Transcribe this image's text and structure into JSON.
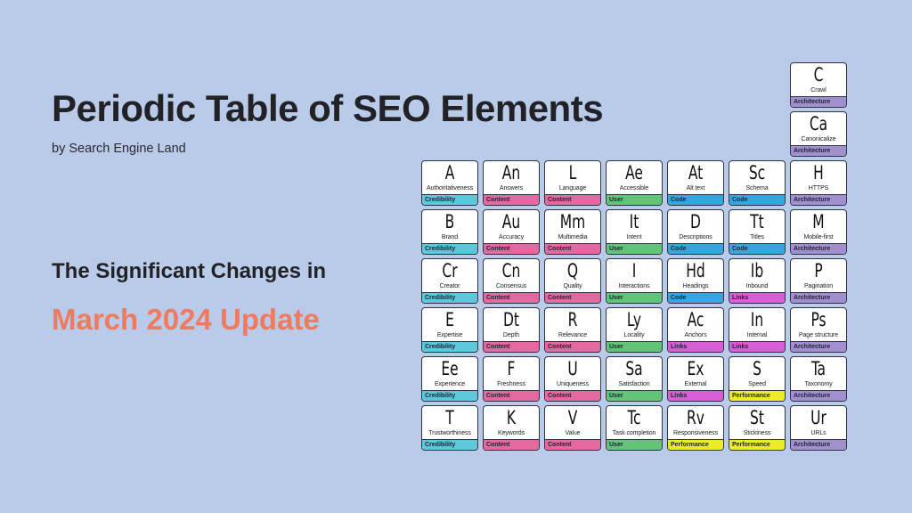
{
  "header": {
    "title": "Periodic Table of SEO Elements",
    "byline": "by Search Engine Land",
    "subhead": "The Significant Changes in",
    "highlight": "March 2024 Update"
  },
  "colors": {
    "background": "#b9cbe8",
    "highlight": "#f07a5e",
    "categories": {
      "Credibility": "#5bc8dc",
      "Content": "#e569a1",
      "User": "#62c478",
      "Code": "#35a7de",
      "Links": "#d65fd6",
      "Performance": "#ecec2a",
      "Architecture": "#a18fcf"
    }
  },
  "table": {
    "top_cells": [
      {
        "symbol": "C",
        "name": "Crawl",
        "category": "Architecture"
      },
      {
        "symbol": "Ca",
        "name": "Canonicalize",
        "category": "Architecture"
      }
    ],
    "rows": [
      [
        {
          "symbol": "A",
          "name": "Authoritativeness",
          "category": "Credibility"
        },
        {
          "symbol": "An",
          "name": "Answers",
          "category": "Content"
        },
        {
          "symbol": "L",
          "name": "Language",
          "category": "Content"
        },
        {
          "symbol": "Ae",
          "name": "Accessible",
          "category": "User"
        },
        {
          "symbol": "At",
          "name": "Alt text",
          "category": "Code"
        },
        {
          "symbol": "Sc",
          "name": "Schema",
          "category": "Code"
        },
        {
          "symbol": "H",
          "name": "HTTPS",
          "category": "Architecture"
        }
      ],
      [
        {
          "symbol": "B",
          "name": "Brand",
          "category": "Credibility"
        },
        {
          "symbol": "Au",
          "name": "Accuracy",
          "category": "Content"
        },
        {
          "symbol": "Mm",
          "name": "Multimedia",
          "category": "Content"
        },
        {
          "symbol": "It",
          "name": "Intent",
          "category": "User"
        },
        {
          "symbol": "D",
          "name": "Descriptions",
          "category": "Code"
        },
        {
          "symbol": "Tt",
          "name": "Titles",
          "category": "Code"
        },
        {
          "symbol": "M",
          "name": "Mobile-first",
          "category": "Architecture"
        }
      ],
      [
        {
          "symbol": "Cr",
          "name": "Creator",
          "category": "Credibility"
        },
        {
          "symbol": "Cn",
          "name": "Consensus",
          "category": "Content"
        },
        {
          "symbol": "Q",
          "name": "Quality",
          "category": "Content"
        },
        {
          "symbol": "I",
          "name": "Interactions",
          "category": "User"
        },
        {
          "symbol": "Hd",
          "name": "Headings",
          "category": "Code"
        },
        {
          "symbol": "Ib",
          "name": "Inbound",
          "category": "Links"
        },
        {
          "symbol": "P",
          "name": "Pagination",
          "category": "Architecture"
        }
      ],
      [
        {
          "symbol": "E",
          "name": "Expertise",
          "category": "Credibility"
        },
        {
          "symbol": "Dt",
          "name": "Depth",
          "category": "Content"
        },
        {
          "symbol": "R",
          "name": "Relevance",
          "category": "Content"
        },
        {
          "symbol": "Ly",
          "name": "Locality",
          "category": "User"
        },
        {
          "symbol": "Ac",
          "name": "Anchors",
          "category": "Links"
        },
        {
          "symbol": "In",
          "name": "Internal",
          "category": "Links"
        },
        {
          "symbol": "Ps",
          "name": "Page structure",
          "category": "Architecture"
        }
      ],
      [
        {
          "symbol": "Ee",
          "name": "Experience",
          "category": "Credibility"
        },
        {
          "symbol": "F",
          "name": "Freshness",
          "category": "Content"
        },
        {
          "symbol": "U",
          "name": "Uniqueness",
          "category": "Content"
        },
        {
          "symbol": "Sa",
          "name": "Satisfaction",
          "category": "User"
        },
        {
          "symbol": "Ex",
          "name": "External",
          "category": "Links"
        },
        {
          "symbol": "S",
          "name": "Speed",
          "category": "Performance"
        },
        {
          "symbol": "Ta",
          "name": "Taxonomy",
          "category": "Architecture"
        }
      ],
      [
        {
          "symbol": "T",
          "name": "Trustworthiness",
          "category": "Credibility"
        },
        {
          "symbol": "K",
          "name": "Keywords",
          "category": "Content"
        },
        {
          "symbol": "V",
          "name": "Value",
          "category": "Content"
        },
        {
          "symbol": "Tc",
          "name": "Task completion",
          "category": "User"
        },
        {
          "symbol": "Rv",
          "name": "Responsiveness",
          "category": "Performance"
        },
        {
          "symbol": "St",
          "name": "Stickiness",
          "category": "Performance"
        },
        {
          "symbol": "Ur",
          "name": "URLs",
          "category": "Architecture"
        }
      ]
    ]
  }
}
